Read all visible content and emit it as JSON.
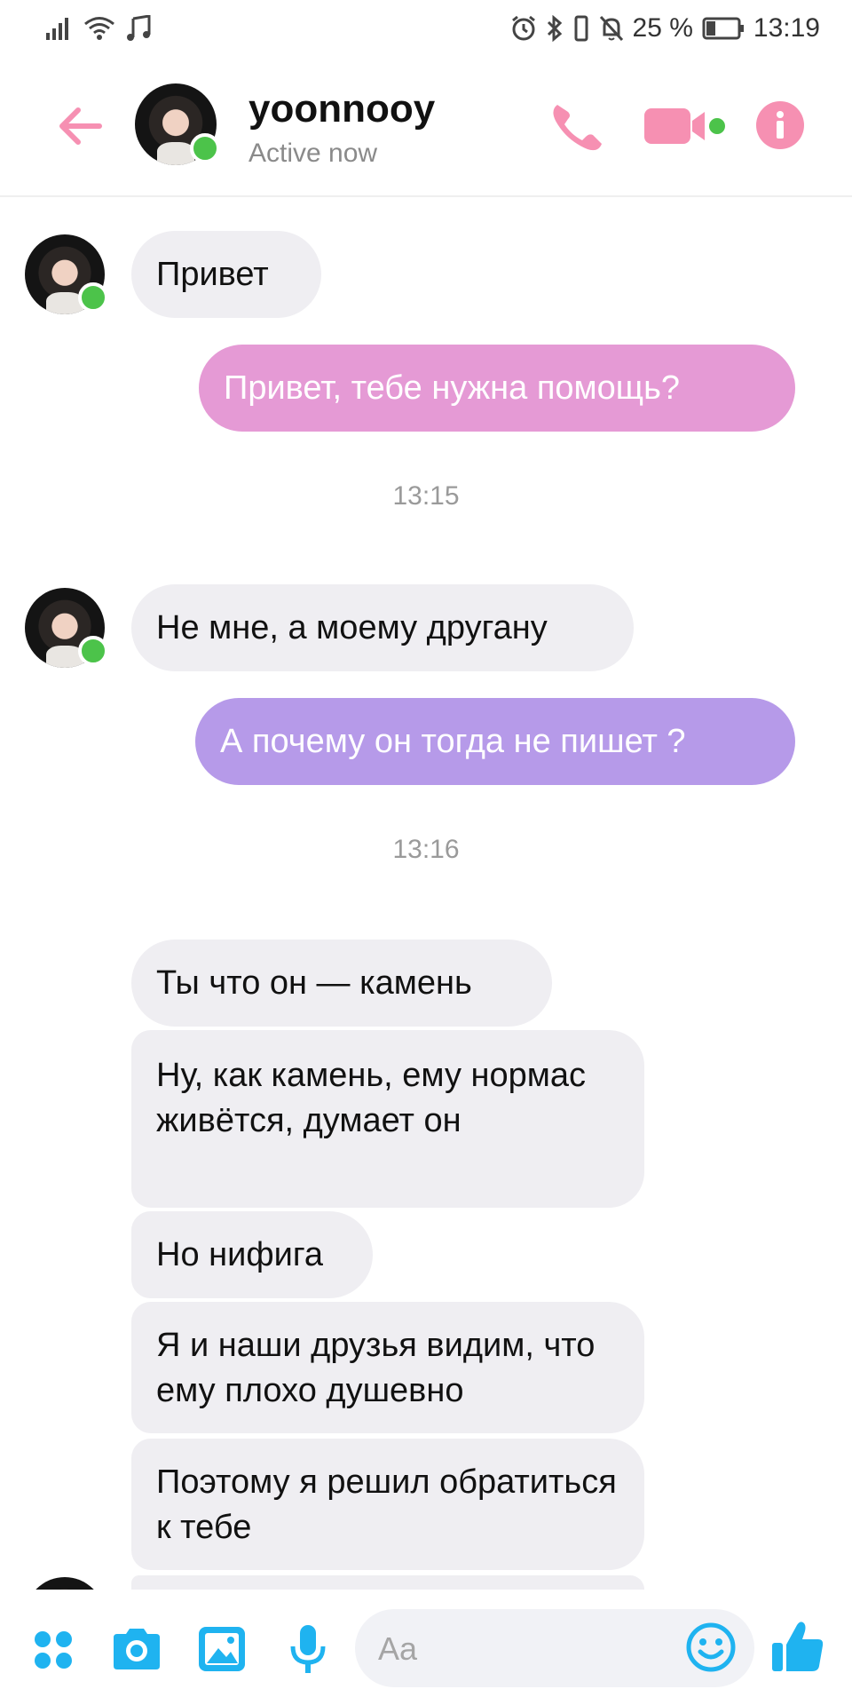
{
  "status_bar": {
    "battery_percent": "25 %",
    "time": "13:19",
    "icons": [
      "signal-icon",
      "wifi-icon",
      "music-note-icon",
      "alarm-icon",
      "bluetooth-icon",
      "vibrate-icon",
      "bell-off-icon",
      "battery-icon"
    ]
  },
  "header": {
    "contact_name": "yoonnooy",
    "status": "Active now",
    "icons": [
      "back-arrow-icon",
      "phone-icon",
      "video-camera-icon",
      "info-icon"
    ]
  },
  "messages": [
    {
      "side": "incoming",
      "text": "Привет"
    },
    {
      "side": "outgoing",
      "text": "Привет, тебе нужна помощь?"
    },
    {
      "timestamp": "13:15"
    },
    {
      "side": "incoming",
      "text": "Не мне, а моему другану"
    },
    {
      "side": "outgoing",
      "text": "А почему он тогда не пишет ?"
    },
    {
      "timestamp": "13:16"
    },
    {
      "side": "incoming",
      "text": "Ты что он — камень"
    },
    {
      "side": "incoming",
      "text": "Ну, как камень, ему нормас живётся, думает он"
    },
    {
      "side": "incoming",
      "text": "Но нифига"
    },
    {
      "side": "incoming",
      "text": "Я и наши друзья видим, что ему плохо душевно"
    },
    {
      "side": "incoming",
      "text": "Поэтому я решил обратиться к тебе"
    }
  ],
  "composer": {
    "placeholder": "Aa",
    "icons": [
      "apps-icon",
      "camera-icon",
      "image-icon",
      "microphone-icon",
      "emoji-icon",
      "thumbs-up-icon"
    ]
  },
  "colors": {
    "accent_pink": "#f690b2",
    "accent_blue": "#1fb3f0",
    "outgoing_pink": "#e59ad5",
    "outgoing_purple": "#b69ae9",
    "incoming_bg": "#efeef2",
    "online_green": "#4cc34a"
  }
}
